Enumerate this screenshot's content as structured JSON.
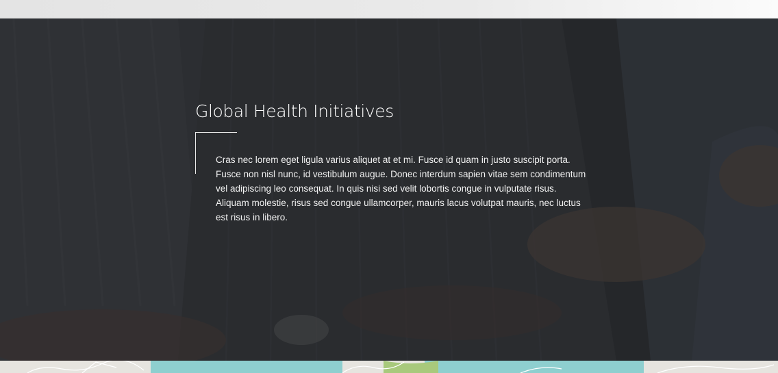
{
  "hero": {
    "title": "Global Health Initiatives",
    "body": "Cras nec lorem eget ligula varius aliquet at et mi. Fusce id quam in justo suscipit porta. Fusce non nisl nunc, id vestibulum augue. Donec interdum sapien vitae sem condimentum vel adipiscing leo consequat. In quis nisi sed velit lobortis congue in vulputate risus. Aliquam molestie, risus sed congue ullamcorper, mauris lacus volutpat mauris, nec luctus est risus in libero."
  },
  "colors": {
    "overlay": "#2a2b2e",
    "map_water": "#8ecfcf",
    "map_land": "#e6e4df",
    "map_park": "#a8c97c"
  }
}
